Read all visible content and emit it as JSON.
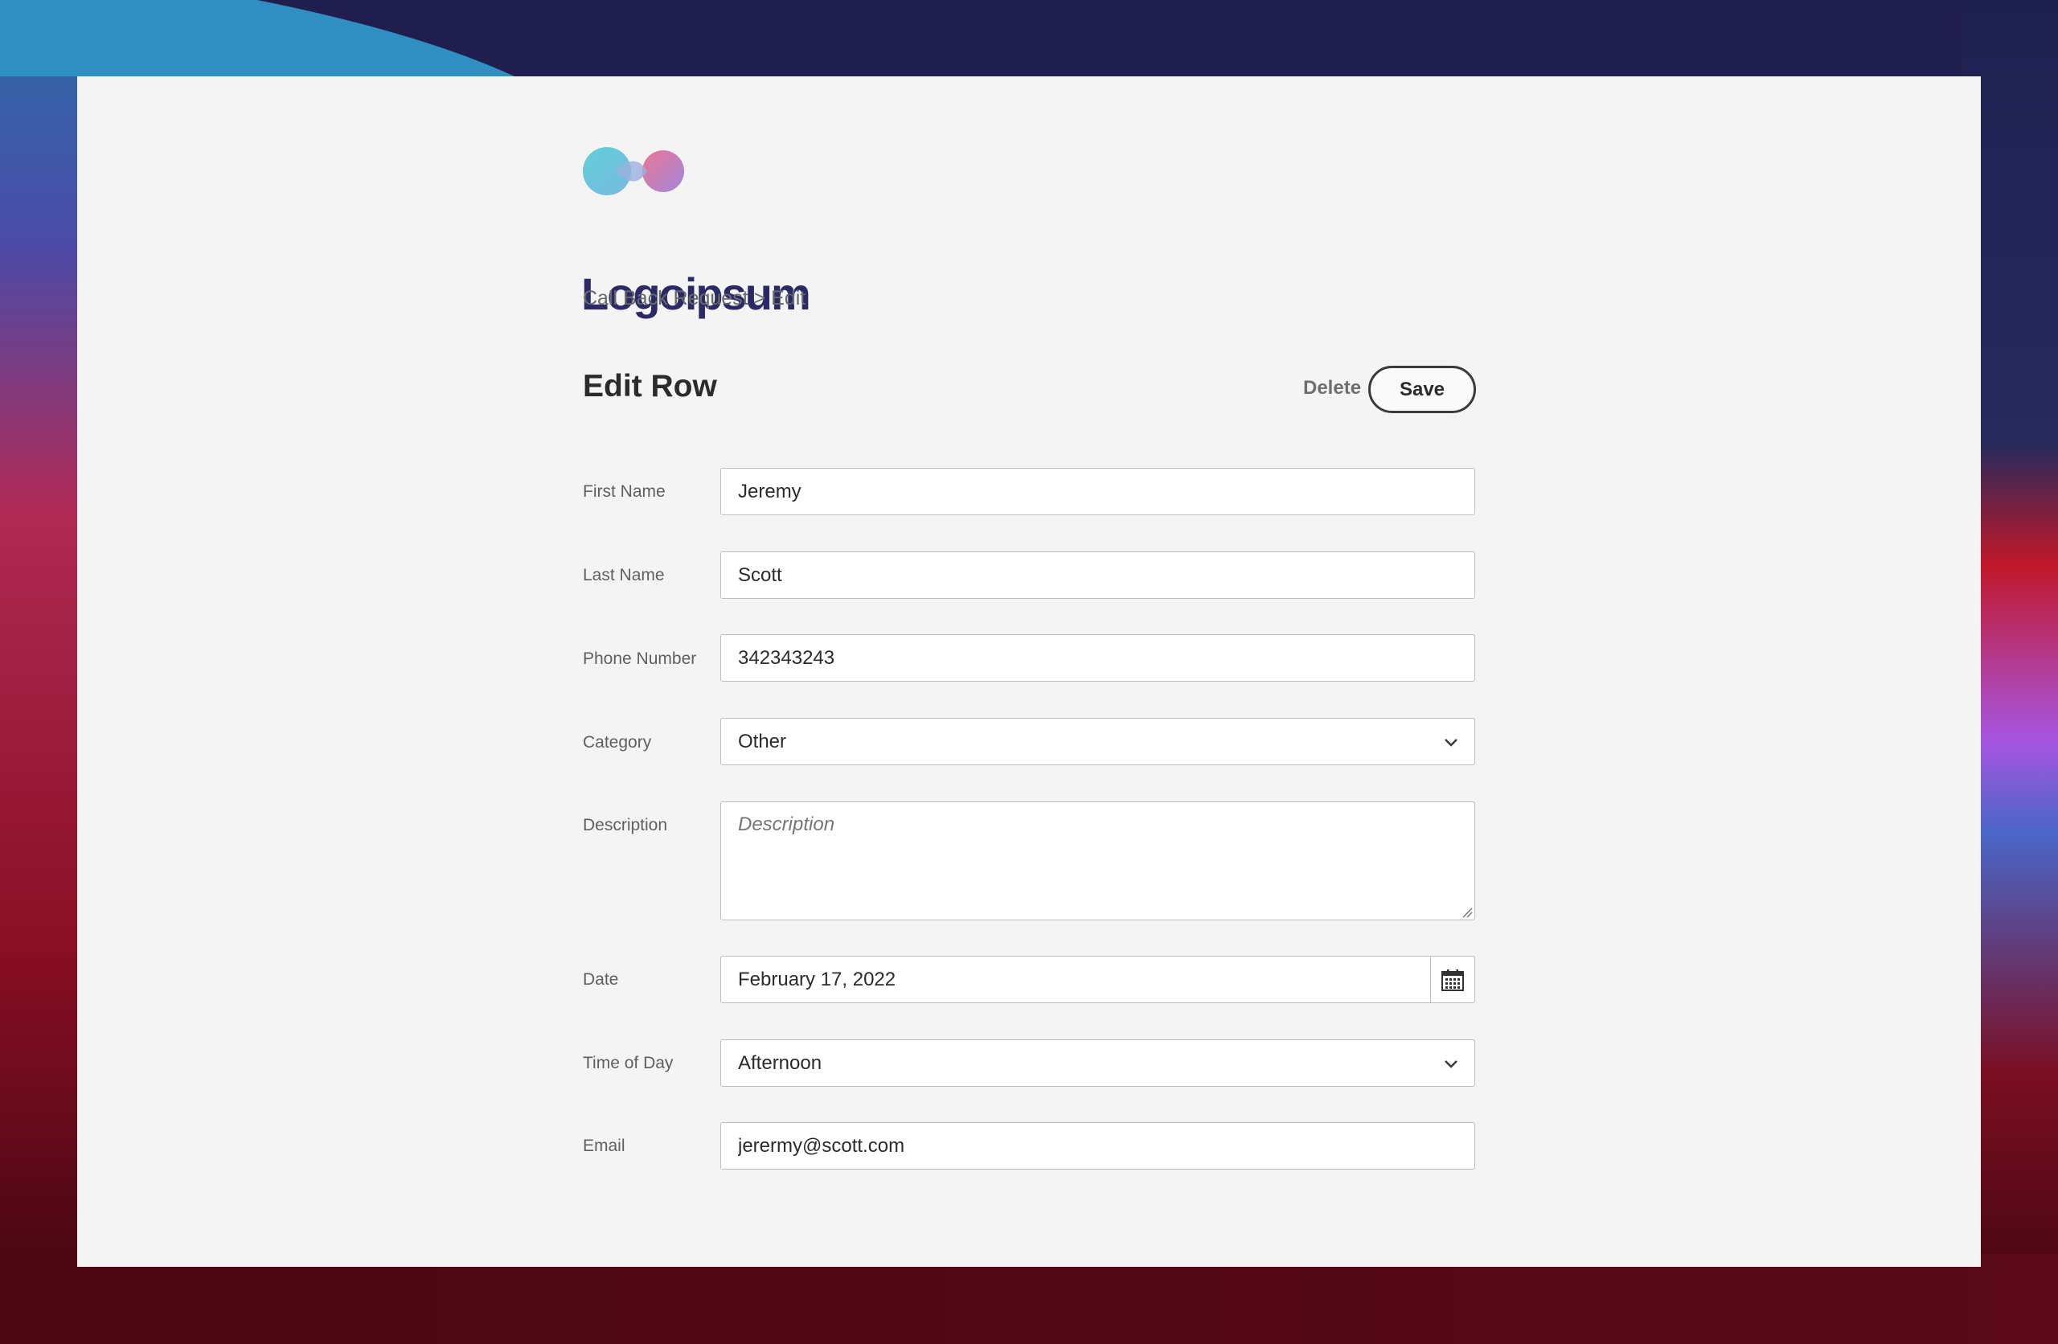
{
  "logo": {
    "text": "Logoipsum"
  },
  "breadcrumb": {
    "parent": "Call Back Request",
    "separator": ">",
    "current": "Edit"
  },
  "header": {
    "title": "Edit Row",
    "delete_label": "Delete",
    "save_label": "Save"
  },
  "form": {
    "first_name": {
      "label": "First Name",
      "value": "Jeremy"
    },
    "last_name": {
      "label": "Last Name",
      "value": "Scott"
    },
    "phone": {
      "label": "Phone Number",
      "value": "342343243"
    },
    "category": {
      "label": "Category",
      "value": "Other"
    },
    "description": {
      "label": "Description",
      "placeholder": "Description",
      "value": ""
    },
    "date": {
      "label": "Date",
      "value": "February 17, 2022"
    },
    "time_of_day": {
      "label": "Time of Day",
      "value": "Afternoon"
    },
    "email": {
      "label": "Email",
      "value": "jerermy@scott.com"
    }
  },
  "colors": {
    "window_bg": "#f4f4f4",
    "logo_text": "#2c2a66",
    "border": "#bdbdbd"
  },
  "icons": [
    "chevron-down-icon",
    "calendar-icon",
    "resize-grip-icon"
  ]
}
